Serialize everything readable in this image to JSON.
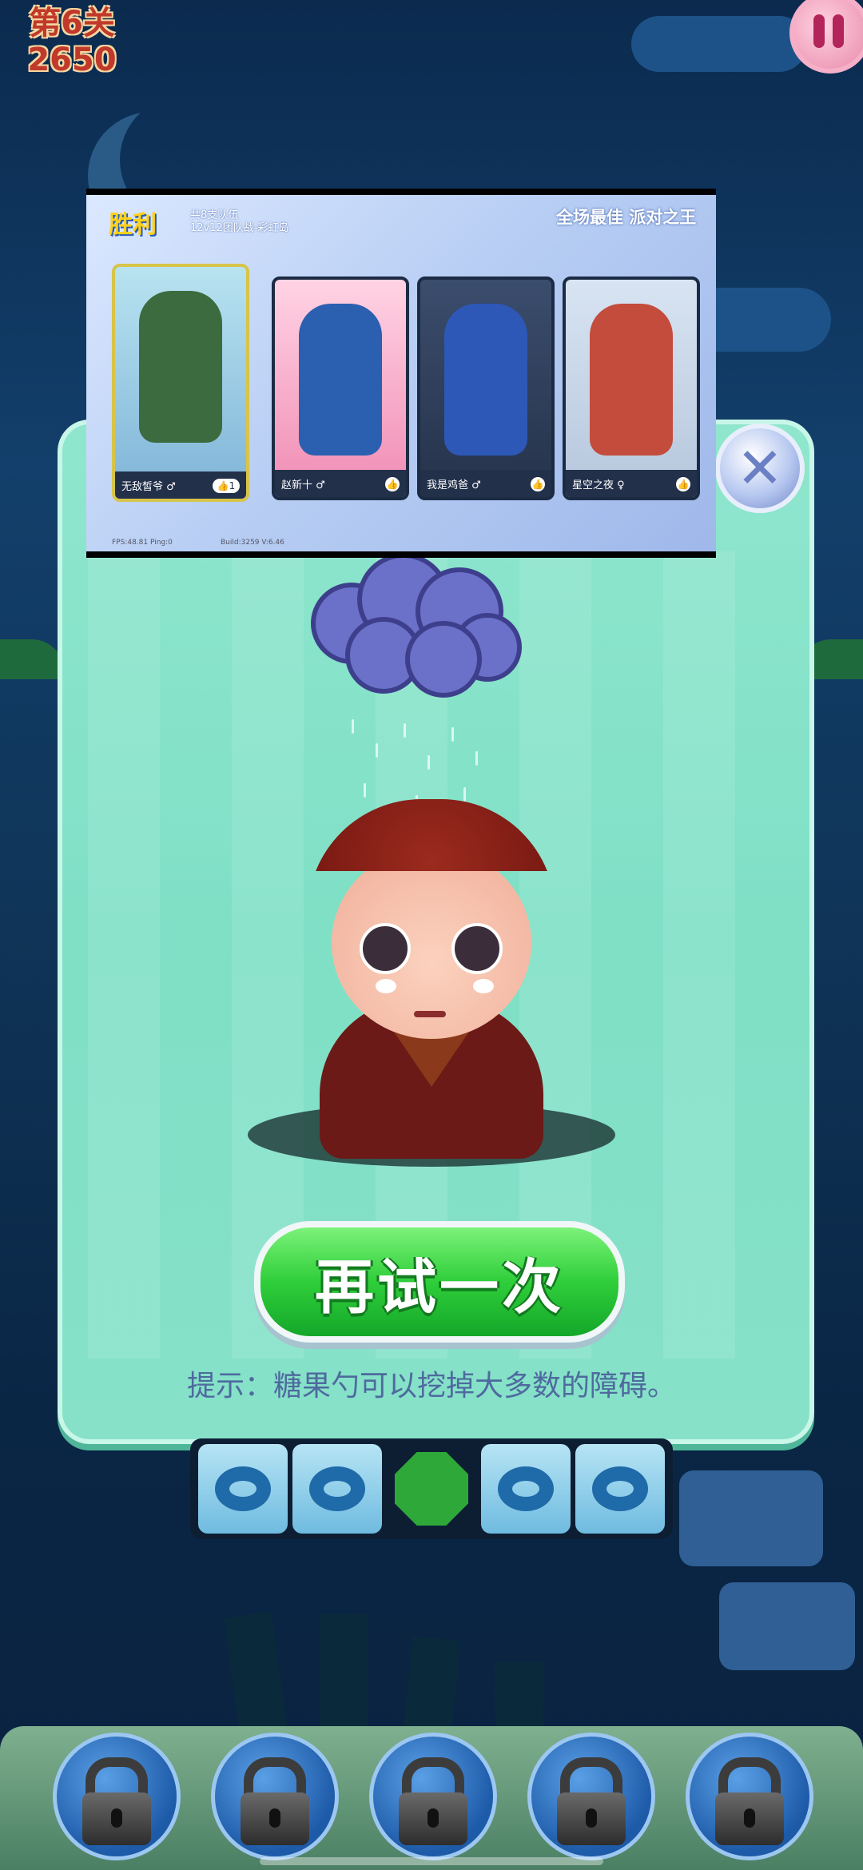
{
  "hud": {
    "level": "第6关",
    "score": "2650"
  },
  "dialog": {
    "retry_label": "再试一次",
    "tip": "提示：糖果勺可以挖掉大多数的障碍。"
  },
  "ad_banner": {
    "result": "胜利",
    "subtitle_line1": "共8支队伍",
    "subtitle_line2": "12v12团队战-彩虹岛",
    "tags": "全场最佳  派对之王",
    "fps": "FPS:48.81 Ping:0",
    "version": "Build:3259 V:6.46",
    "cards": [
      {
        "name": "无敌皙爷 ♂",
        "likes": "1",
        "color": "#2f6b46"
      },
      {
        "name": "赵新十 ♂",
        "likes": "",
        "color": "#e8527e"
      },
      {
        "name": "我是鸡爸 ♂",
        "likes": "",
        "color": "#2b4f9c"
      },
      {
        "name": "星空之夜 ♀",
        "likes": "",
        "color": "#c7463a"
      }
    ]
  },
  "tiles": [
    "ice-donut",
    "ice-donut",
    "green-gem",
    "ice-donut",
    "ice-donut"
  ],
  "locks_count": 5,
  "colors": {
    "dialog_bg": "#7fe0c6",
    "retry_green": "#2fce3a",
    "level_red": "#c0392b"
  }
}
